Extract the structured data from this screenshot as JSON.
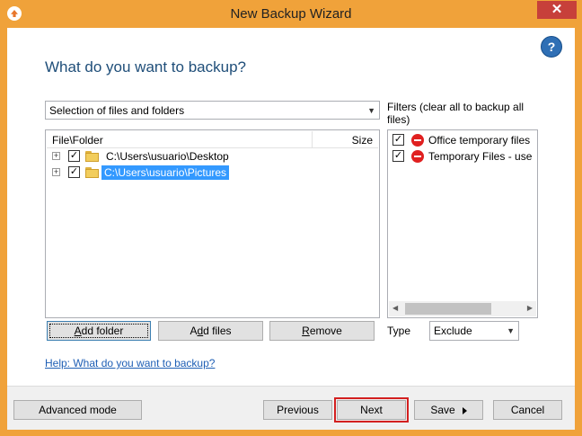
{
  "window": {
    "title": "New Backup Wizard",
    "close_glyph": "✕"
  },
  "heading": "What do you want to backup?",
  "source_select": {
    "value": "Selection of files and folders",
    "arrow_glyph": "▼"
  },
  "file_list": {
    "columns": [
      "File\\Folder",
      "Size"
    ],
    "rows": [
      {
        "path": "C:\\Users\\usuario\\Desktop",
        "checked": true,
        "selected": false
      },
      {
        "path": "C:\\Users\\usuario\\Pictures",
        "checked": true,
        "selected": true
      }
    ]
  },
  "filters": {
    "label": "Filters (clear all to backup all files)",
    "items": [
      {
        "name": "Office temporary files",
        "checked": true
      },
      {
        "name": "Temporary Files - use",
        "checked": true
      }
    ],
    "scroll_left_glyph": "◀",
    "scroll_right_glyph": "▶"
  },
  "buttons": {
    "add_folder": {
      "pre": "",
      "u": "A",
      "post": "dd folder"
    },
    "add_files": {
      "pre": "A",
      "u": "d",
      "post": "d files"
    },
    "remove": {
      "pre": "",
      "u": "R",
      "post": "emove"
    }
  },
  "type": {
    "label": "Type",
    "value": "Exclude",
    "arrow_glyph": "▼"
  },
  "help_link": "Help: What do you want to backup?",
  "footer": {
    "advanced_mode": "Advanced mode",
    "previous": "Previous",
    "next": "Next",
    "save": "Save",
    "cancel": "Cancel"
  },
  "icons": {
    "check_glyph": "✓",
    "expander_glyph": "+",
    "help_glyph": "?"
  },
  "colors": {
    "accent_orange": "#f0a23a",
    "selection_blue": "#3399ff",
    "link_blue": "#1f5fb5",
    "heading_blue": "#1f4e79",
    "next_highlight": "#d32020"
  }
}
